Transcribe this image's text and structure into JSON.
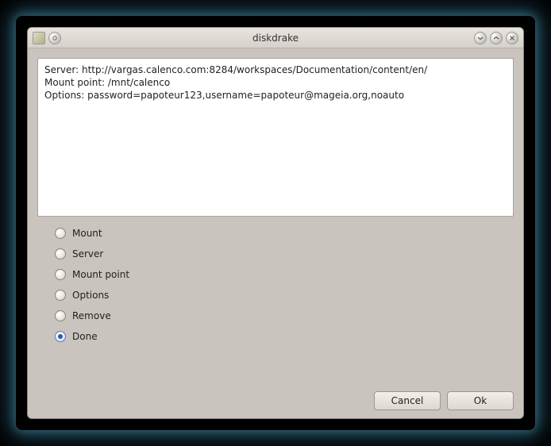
{
  "window": {
    "title": "diskdrake"
  },
  "info": {
    "line1": "Server: http://vargas.calenco.com:8284/workspaces/Documentation/content/en/",
    "line2": "Mount point: /mnt/calenco",
    "line3": "Options: password=papoteur123,username=papoteur@mageia.org,noauto"
  },
  "options": {
    "mount": "Mount",
    "server": "Server",
    "mount_point": "Mount point",
    "options_label": "Options",
    "remove": "Remove",
    "done": "Done",
    "selected": "done"
  },
  "buttons": {
    "cancel": "Cancel",
    "ok": "Ok"
  }
}
